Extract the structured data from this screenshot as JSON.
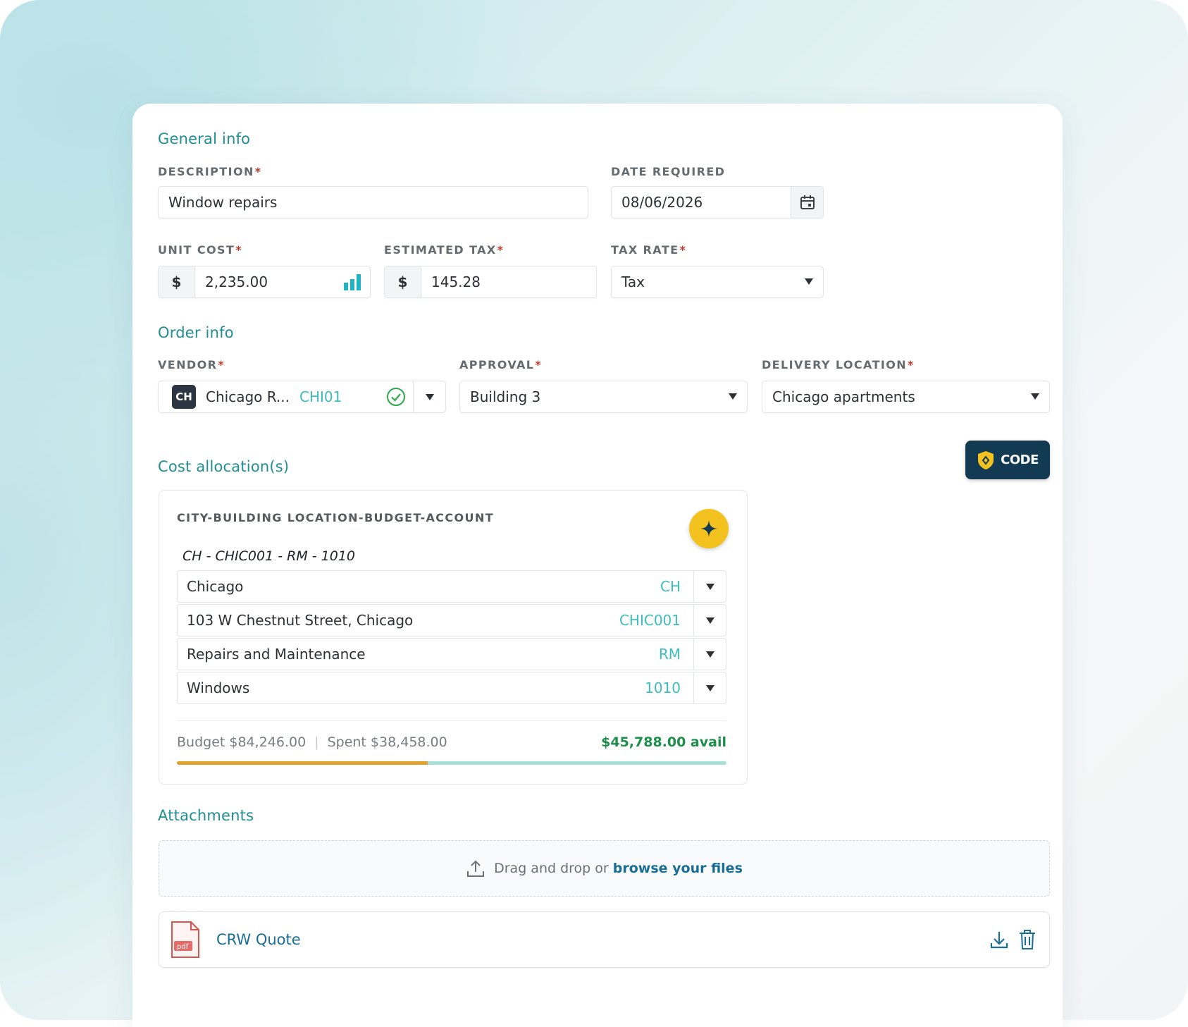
{
  "colors": {
    "accent": "#1f8f93",
    "teal_code": "#3dbcc0",
    "navy": "#123a52",
    "gold": "#f4c21f",
    "budget_orange": "#e2a12b",
    "budget_track": "#a8e0d8",
    "avail_green": "#1e8f4a"
  },
  "general_info": {
    "title": "General info",
    "description": {
      "label": "DESCRIPTION",
      "value": "Window repairs"
    },
    "date_required": {
      "label": "DATE REQUIRED",
      "value": "08/06/2026",
      "icon": "calendar-icon"
    },
    "unit_cost": {
      "label": "UNIT COST",
      "currency": "$",
      "value": "2,235.00",
      "icon": "bar-chart-icon"
    },
    "estimated_tax": {
      "label": "ESTIMATED TAX",
      "currency": "$",
      "value": "145.28"
    },
    "tax_rate": {
      "label": "TAX RATE",
      "value": "Tax"
    }
  },
  "order_info": {
    "title": "Order info",
    "vendor": {
      "label": "VENDOR",
      "badge": "CH",
      "name": "Chicago R...",
      "code": "CHI01",
      "status_icon": "check-circle-icon"
    },
    "approval": {
      "label": "APPROVAL",
      "value": "Building 3"
    },
    "delivery_location": {
      "label": "DELIVERY LOCATION",
      "value": "Chicago apartments"
    }
  },
  "cost_allocation": {
    "title": "Cost allocation(s)",
    "code_button": "CODE",
    "segment_label": "CITY-BUILDING LOCATION-BUDGET-ACCOUNT",
    "segment_value": "CH - CHIC001 - RM - 1010",
    "rows": [
      {
        "name": "Chicago",
        "code": "CH"
      },
      {
        "name": "103 W Chestnut Street, Chicago",
        "code": "CHIC001"
      },
      {
        "name": "Repairs and Maintenance",
        "code": "RM"
      },
      {
        "name": "Windows",
        "code": "1010"
      }
    ],
    "budget": "Budget $84,246.00",
    "separator": "|",
    "spent": "Spent $38,458.00",
    "available": "$45,788.00 avail",
    "spent_fraction": 0.4565
  },
  "attachments": {
    "title": "Attachments",
    "drop_text": "Drag and drop or",
    "browse_text": "browse your files",
    "files": [
      {
        "name": "CRW Quote",
        "type": "pdf"
      }
    ]
  }
}
